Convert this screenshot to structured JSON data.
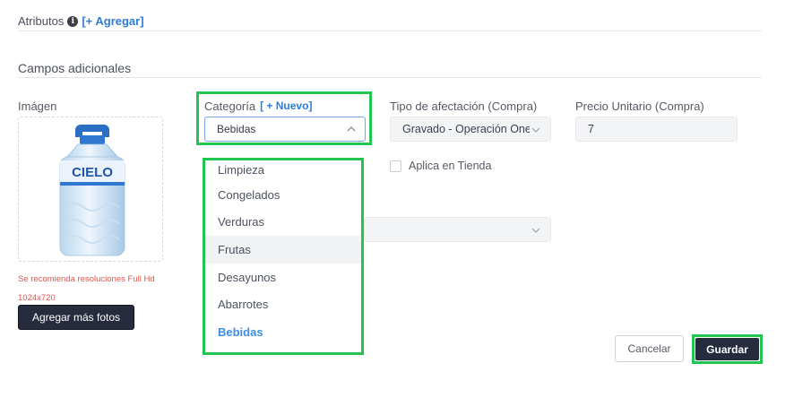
{
  "atributos": {
    "label": "Atributos",
    "info_icon": "i",
    "add_link": "[+ Agregar]"
  },
  "campos": {
    "title": "Campos adicionales"
  },
  "image": {
    "label": "Imágen",
    "product_brand": "CIELO",
    "recommendation": "Se recomienda resoluciones Full Hd 1024x720",
    "more_photos_button": "Agregar más fotos"
  },
  "categoria": {
    "label": "Categoría",
    "new_link": "[ + Nuevo]",
    "selected": "Bebidas",
    "options": [
      "Limpieza",
      "Congelados",
      "Verduras",
      "Frutas",
      "Desayunos",
      "Abarrotes",
      "Bebidas"
    ],
    "hovered_option": "Frutas"
  },
  "tipo_afectacion": {
    "label": "Tipo de afectación (Compra)",
    "value": "Gravado - Operación Onerosa"
  },
  "precio_unitario": {
    "label": "Precio Unitario (Compra)",
    "value": "7"
  },
  "tienda": {
    "label": "Aplica en Tienda",
    "checked": false
  },
  "actions": {
    "cancel": "Cancelar",
    "save": "Guardar"
  },
  "colors": {
    "highlight": "#23c552",
    "link": "#2f7bdc",
    "dark_button": "#262b3d",
    "warning": "#e2554f"
  }
}
